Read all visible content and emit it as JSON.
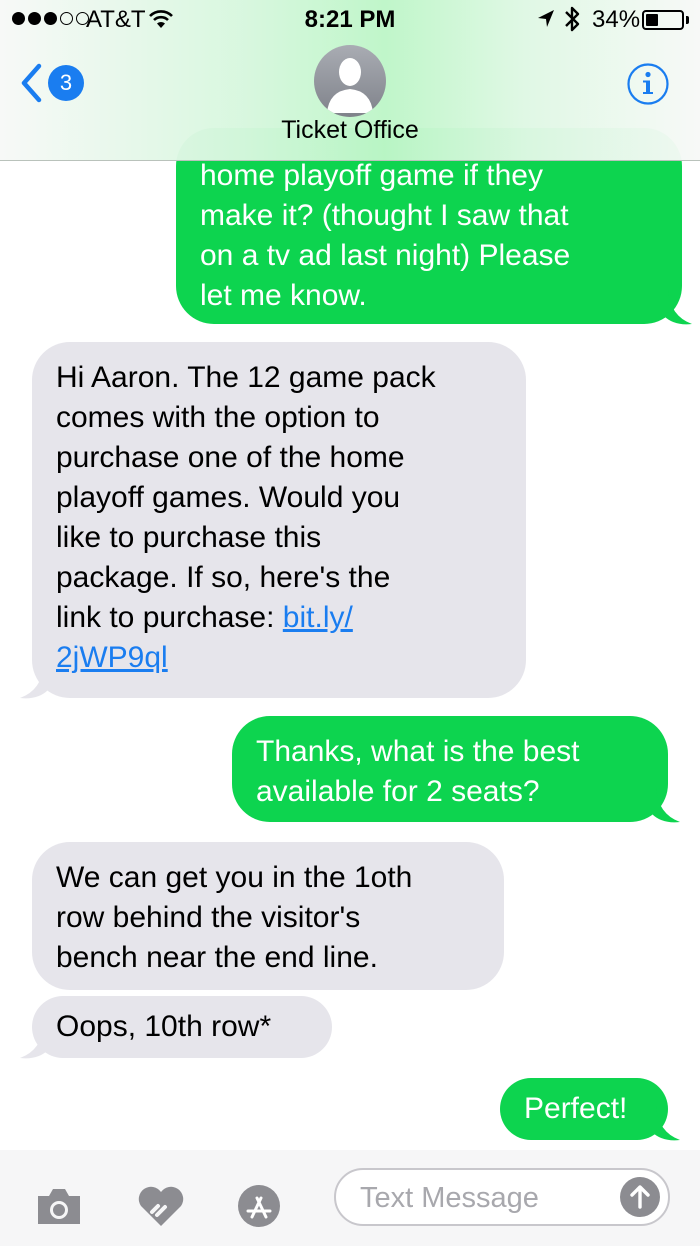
{
  "status_bar": {
    "carrier": "AT&T",
    "time": "8:21 PM",
    "battery_percent": "34%",
    "battery_level": 0.34,
    "signal_bars_filled": 3,
    "signal_bars_total": 5
  },
  "header": {
    "back_badge": "3",
    "contact_name": "Ticket Office"
  },
  "messages": [
    {
      "direction": "outgoing",
      "lines": [
        "home playoff game if they",
        "make it? (thought I saw that",
        "on a tv ad last night)  Please",
        "let me know."
      ]
    },
    {
      "direction": "incoming",
      "lines": [
        "Hi Aaron. The 12 game pack",
        "comes with the option to",
        "purchase one of the home",
        "playoff games. Would you",
        "like to purchase this",
        "package. If so, here's the"
      ],
      "link_prefix": "link to purchase: ",
      "link_text_1": "bit.ly/",
      "link_text_2": "2jWP9ql"
    },
    {
      "direction": "outgoing",
      "lines": [
        "Thanks, what is the best",
        "available for 2 seats?"
      ]
    },
    {
      "direction": "incoming",
      "lines": [
        "We can get you in the 1oth",
        "row behind the visitor's",
        "bench near the end line."
      ]
    },
    {
      "direction": "incoming",
      "lines": [
        "Oops, 10th row*"
      ]
    },
    {
      "direction": "outgoing",
      "lines": [
        "Perfect!"
      ]
    }
  ],
  "input_bar": {
    "placeholder": "Text Message"
  },
  "colors": {
    "outgoing_bubble": "#0dd44f",
    "incoming_bubble": "#e6e5eb",
    "accent": "#1a7df0"
  }
}
